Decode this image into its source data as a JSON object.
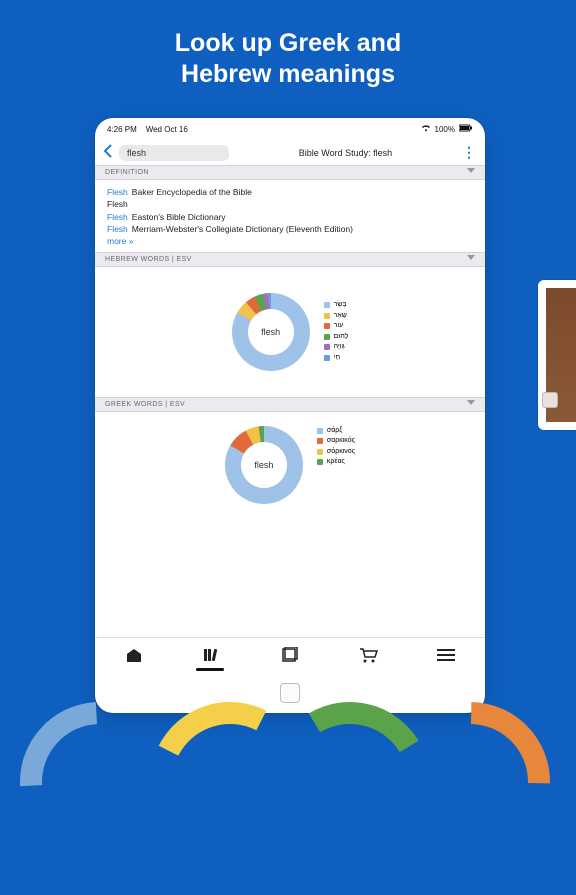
{
  "marketing": {
    "headline_l1": "Look up Greek and",
    "headline_l2": "Hebrew meanings"
  },
  "statusbar": {
    "time": "4:26 PM",
    "date": "Wed Oct 16",
    "wifi": "wifi",
    "battery": "100%"
  },
  "nav": {
    "search_value": "flesh",
    "title": "Bible Word Study: flesh"
  },
  "sections": {
    "definition": "DEFINITION",
    "hebrew": "HEBREW WORDS | ESV",
    "greek": "GREEK WORDS | ESV"
  },
  "definitions": {
    "items": [
      {
        "word": "Flesh",
        "src": "Baker Encyclopedia of the Bible"
      },
      {
        "word": "Flesh",
        "src": ""
      },
      {
        "word": "Flesh",
        "src": "Easton's Bible Dictionary"
      },
      {
        "word": "Flesh",
        "src": "Merriam-Webster's Collegiate Dictionary (Eleventh Edition)"
      }
    ],
    "more": "more »"
  },
  "chart_data": [
    {
      "type": "pie",
      "title": "flesh",
      "series_name": "Hebrew words",
      "categories": [
        "בָּשָׂר",
        "שְׁאֵר",
        "עוֹר",
        "לְחוּם",
        "גְּוִיָּה",
        "חַי"
      ],
      "values": [
        83,
        6,
        4,
        3,
        2,
        2
      ],
      "colors": [
        "#9ec2e8",
        "#f0c24a",
        "#e06a3c",
        "#5aa34a",
        "#a070c0",
        "#6aa0d8"
      ]
    },
    {
      "type": "pie",
      "title": "flesh",
      "series_name": "Greek words",
      "categories": [
        "σάρξ",
        "σαρκικός",
        "σάρκινος",
        "κρέας"
      ],
      "values": [
        83,
        9,
        6,
        2
      ],
      "colors": [
        "#9ec2e8",
        "#e06a3c",
        "#f0c24a",
        "#5aa34a"
      ]
    }
  ],
  "bottombar": {
    "home": "home-icon",
    "library": "library-icon",
    "read": "read-icon",
    "store": "store-icon",
    "menu": "menu-icon"
  },
  "fan_colors": [
    "#7aa8d8",
    "#f4cf4a",
    "#5aa34a",
    "#e8863c"
  ]
}
